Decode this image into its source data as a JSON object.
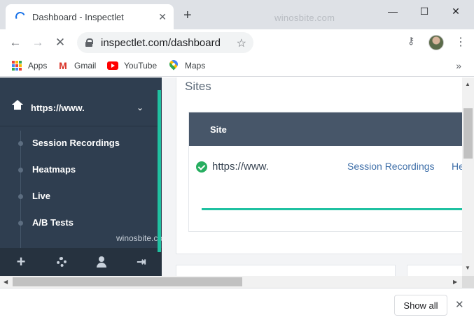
{
  "browser": {
    "tab_title": "Dashboard - Inspectlet",
    "tab_close": "✕",
    "new_tab": "+",
    "watermark": "winosbite.com",
    "window_controls": {
      "minimize": "—",
      "maximize": "☐",
      "close": "✕"
    },
    "nav": {
      "back": "←",
      "forward": "→",
      "stop": "✕"
    },
    "url": "inspectlet.com/dashboard",
    "star": "☆",
    "key": "⚷",
    "menu": "⋮"
  },
  "bookmarks": {
    "items": [
      {
        "label": "Apps",
        "icon": "apps-grid-icon"
      },
      {
        "label": "Gmail",
        "icon": "gmail-icon"
      },
      {
        "label": "YouTube",
        "icon": "youtube-icon"
      },
      {
        "label": "Maps",
        "icon": "maps-icon"
      }
    ],
    "more": "»"
  },
  "sidebar": {
    "site_label": "https://www.",
    "chevron": "⌄",
    "items": [
      {
        "label": "Session Recordings"
      },
      {
        "label": "Heatmaps"
      },
      {
        "label": "Live"
      },
      {
        "label": "A/B Tests"
      }
    ],
    "watermark": "winosbite.com",
    "footer_icons": [
      "plus-icon",
      "gear-icon",
      "user-icon",
      "sign-out-icon"
    ],
    "footer_plus": "+",
    "footer_signout": "⇥"
  },
  "main": {
    "sites_title": "Sites",
    "table": {
      "header": "Site",
      "rows": [
        {
          "url": "https://www.",
          "link1": "Session Recordings",
          "link2": "He"
        }
      ]
    }
  },
  "download_bar": {
    "show_all": "Show all",
    "close": "✕"
  },
  "colors": {
    "sidebar_bg": "#2f3e50",
    "accent": "#1fc1a1",
    "table_header": "#475669",
    "link": "#3d6ea8",
    "check": "#27ae60"
  }
}
